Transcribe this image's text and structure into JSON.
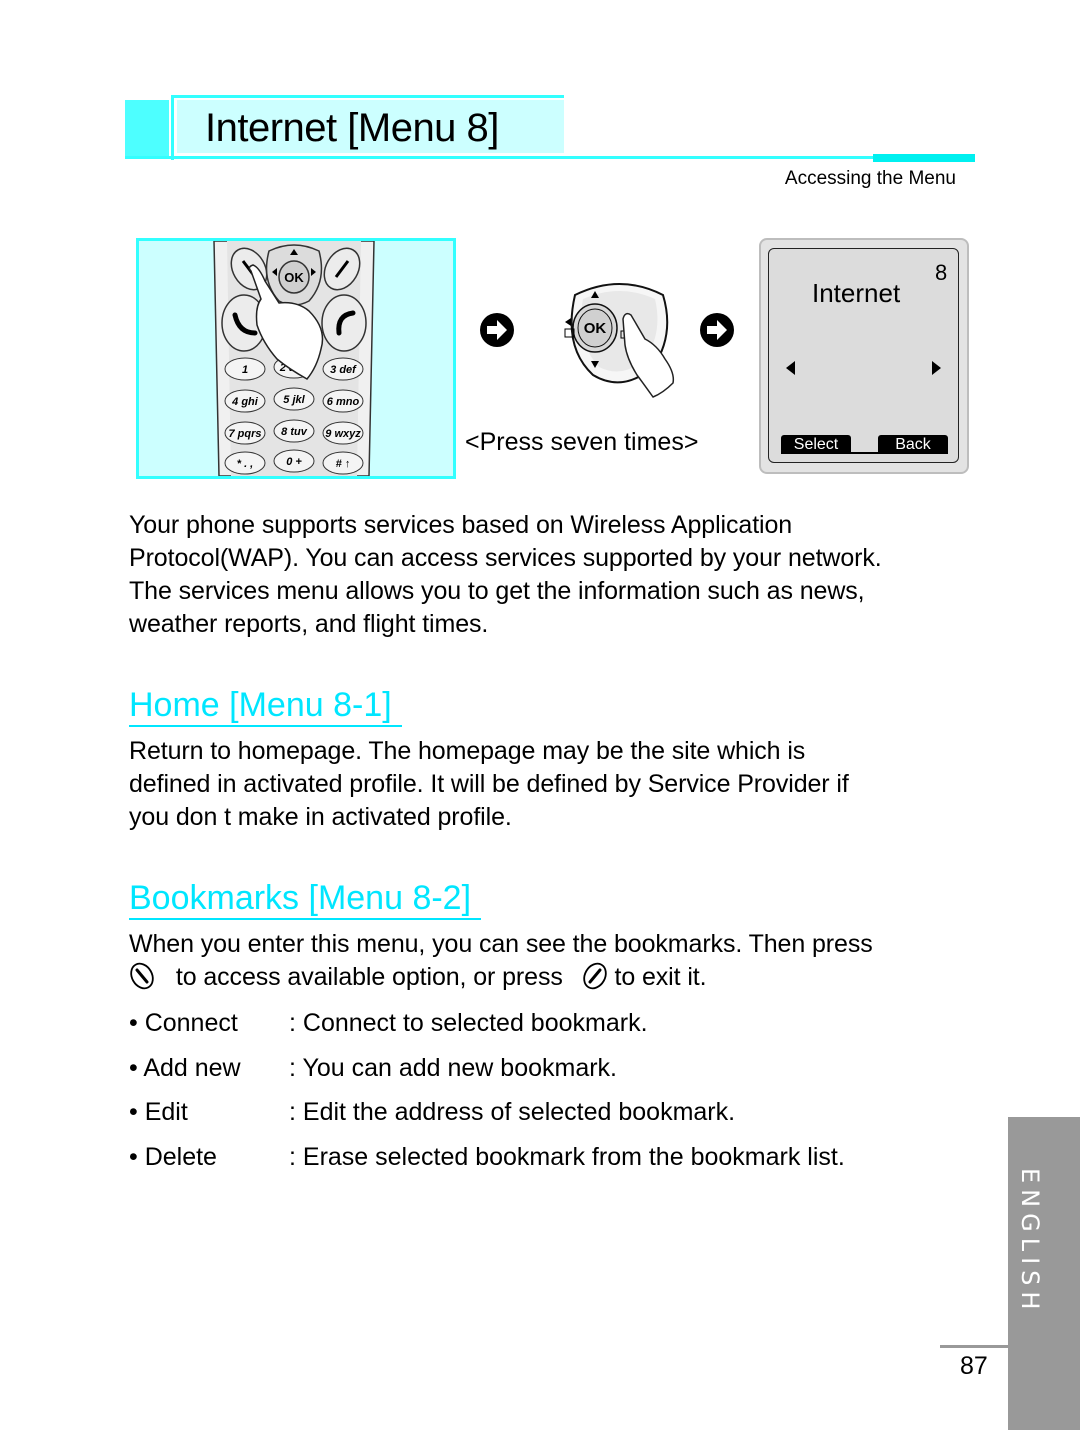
{
  "header": {
    "title": "Internet [Menu 8]",
    "subtitle": "Accessing the Menu"
  },
  "illustration": {
    "phone_keys": [
      "1",
      "2 abc",
      "3 def",
      "4 ghi",
      "5 jkl",
      "6 mno",
      "7 pqrs",
      "8 tuv",
      "9 wxyz",
      "* . ,",
      "0 +",
      "# ↑"
    ],
    "ok_label": "OK",
    "instruction": "<Press seven times>",
    "screen": {
      "menu_number": "8",
      "menu_title": "Internet",
      "left_softkey": "Select",
      "right_softkey": "Back"
    }
  },
  "intro": {
    "lines": [
      "Your phone supports services based on Wireless Application",
      "Protocol(WAP). You can access services supported by your network.",
      "The services menu allows you to get the information such as news,",
      "weather reports, and flight times."
    ]
  },
  "home_section": {
    "title": "Home [Menu 8-1]",
    "lines": [
      "Return to homepage. The homepage may be the site which is",
      "defined in activated profile. It will be defined by Service Provider if",
      "you don t make in activated profile."
    ]
  },
  "bookmarks_section": {
    "title": "Bookmarks [Menu 8-2]",
    "line1": "When you enter this menu, you can see the bookmarks. Then press",
    "line2_part1": "to access available option, or press",
    "line2_part2": "to exit it.",
    "options": [
      {
        "term": "• Connect",
        "desc": ": Connect to selected bookmark."
      },
      {
        "term": "• Add new",
        "desc": ": You can add new bookmark."
      },
      {
        "term": "• Edit",
        "desc": ": Edit the address of selected bookmark."
      },
      {
        "term": "• Delete",
        "desc": ": Erase selected bookmark from the bookmark list."
      }
    ]
  },
  "side_tab": {
    "language": "ENGLISH",
    "page_number": "87"
  },
  "colors": {
    "accent_cyan": "#00e6ff",
    "header_fill": "#ccffff",
    "tab_gray": "#999999"
  }
}
